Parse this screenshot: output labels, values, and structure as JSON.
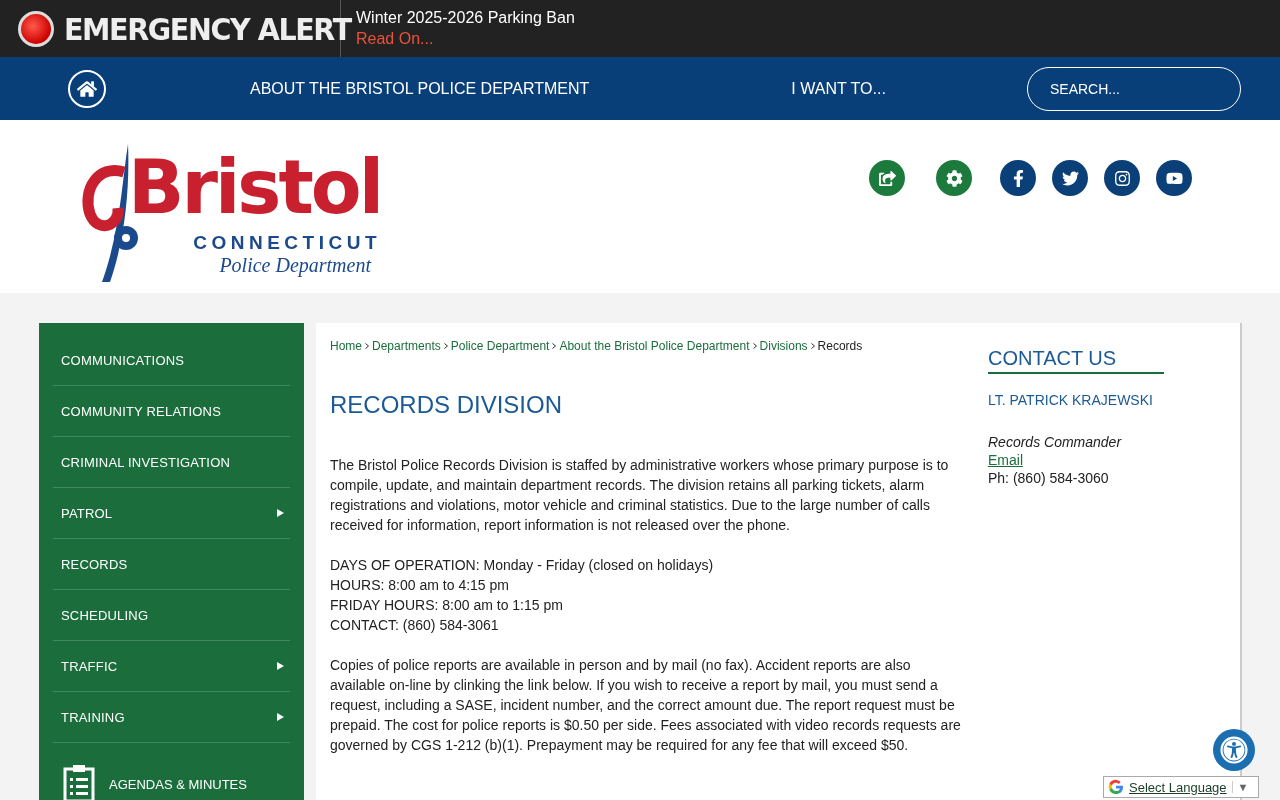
{
  "alert": {
    "label": "EMERGENCY ALERT",
    "title": "Winter 2025-2026 Parking Ban",
    "link": "Read On..."
  },
  "nav": {
    "items": [
      "ABOUT THE BRISTOL POLICE DEPARTMENT",
      "I WANT TO..."
    ],
    "search": {
      "placeholder": "SEARCH..."
    }
  },
  "logo": {
    "name": "Bristol",
    "state": "CONNECTICUT",
    "department": "Police Department"
  },
  "sidebar": {
    "items": [
      {
        "label": "COMMUNICATIONS",
        "has_submenu": false
      },
      {
        "label": "COMMUNITY RELATIONS",
        "has_submenu": false
      },
      {
        "label": "CRIMINAL INVESTIGATION",
        "has_submenu": false
      },
      {
        "label": "PATROL",
        "has_submenu": true
      },
      {
        "label": "RECORDS",
        "has_submenu": false
      },
      {
        "label": "SCHEDULING",
        "has_submenu": false
      },
      {
        "label": "TRAFFIC",
        "has_submenu": true
      },
      {
        "label": "TRAINING",
        "has_submenu": true
      }
    ],
    "feature": "AGENDAS & MINUTES"
  },
  "breadcrumb": [
    {
      "label": "Home",
      "link": true
    },
    {
      "label": "Departments",
      "link": true
    },
    {
      "label": "Police Department",
      "link": true
    },
    {
      "label": "About the Bristol Police Department",
      "link": true
    },
    {
      "label": "Divisions",
      "link": true
    },
    {
      "label": "Records",
      "link": false
    }
  ],
  "page_title": "RECORDS DIVISION",
  "paragraphs": [
    [
      "The Bristol Police Records Division is staffed by administrative workers whose primary purpose is to compile, update, and maintain department records. The division retains all parking tickets, alarm registrations and violations, motor vehicle and criminal statistics. Due to the large number of calls received for information, report information is not released over the phone."
    ],
    [
      "DAYS OF OPERATION: Monday - Friday (closed on holidays)",
      "HOURS: 8:00 am to 4:15 pm",
      "FRIDAY HOURS: 8:00 am to 1:15 pm",
      "CONTACT: (860) 584-3061"
    ],
    [
      "Copies of police reports are available in person and by mail (no fax). Accident reports are also available on-line by clinking the link below. If you wish to receive a report by mail, you must send a request, including a SASE, incident number, and the correct amount due. The report request must be prepaid. The cost for police reports is $0.50 per side. Fees associated with video records requests are governed by CGS 1-212 (b)(1).  Prepayment may be required for any fee that will exceed $50."
    ]
  ],
  "contact": {
    "heading": "CONTACT US",
    "name": "LT. PATRICK KRAJEWSKI",
    "role": "Records Commander",
    "email": "Email",
    "phone": "Ph: (860) 584-3060"
  },
  "translate": {
    "label": "Select Language",
    "caret": "▼"
  }
}
